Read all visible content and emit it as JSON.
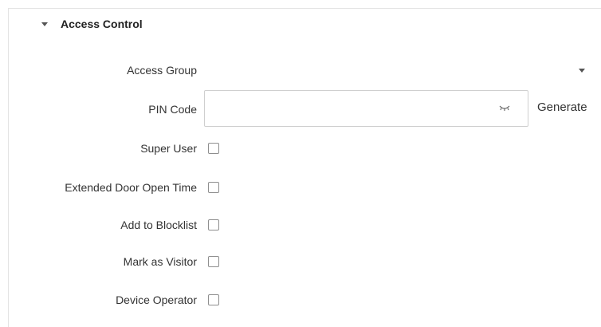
{
  "section": {
    "title": "Access Control",
    "caret_icon": "caret-down-icon"
  },
  "access_group": {
    "label": "Access Group",
    "value": "",
    "caret_icon": "caret-down-icon"
  },
  "pin_code": {
    "label": "PIN Code",
    "value": "",
    "visibility_icon": "eye-closed-icon",
    "generate_label": "Generate"
  },
  "checkboxes": [
    {
      "label": "Super User",
      "checked": false
    },
    {
      "label": "Extended Door Open Time",
      "checked": false
    },
    {
      "label": "Add to Blocklist",
      "checked": false
    },
    {
      "label": "Mark as Visitor",
      "checked": false
    },
    {
      "label": "Device Operator",
      "checked": false
    }
  ]
}
